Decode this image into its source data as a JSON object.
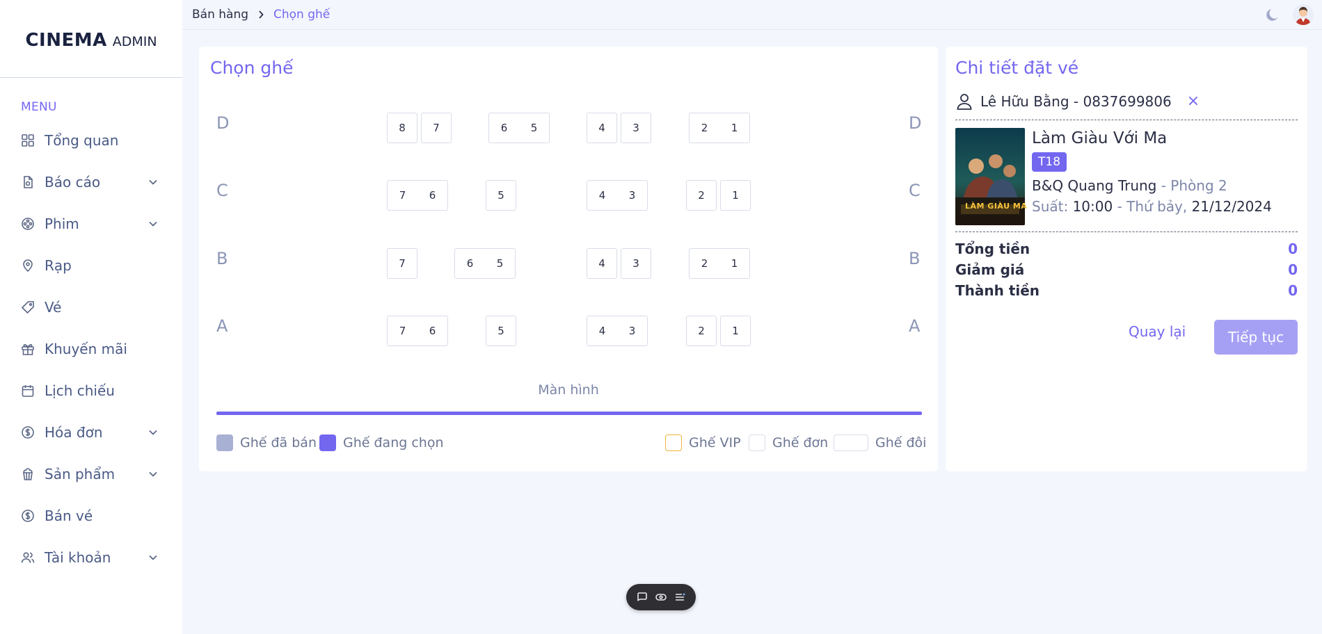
{
  "sidebar": {
    "logo_big": "CINEMA",
    "logo_small": "ADMIN",
    "menu_title": "MENU",
    "items": [
      {
        "label": "Tổng quan",
        "icon": "grid-icon"
      },
      {
        "label": "Báo cáo",
        "icon": "report-icon",
        "expandable": true
      },
      {
        "label": "Phim",
        "icon": "film-reel-icon",
        "expandable": true
      },
      {
        "label": "Rạp",
        "icon": "map-pin-icon"
      },
      {
        "label": "Vé",
        "icon": "ticket-tag-icon"
      },
      {
        "label": "Khuyến mãi",
        "icon": "gift-icon"
      },
      {
        "label": "Lịch chiếu",
        "icon": "calendar-icon"
      },
      {
        "label": "Hóa đơn",
        "icon": "dollar-circle-icon",
        "expandable": true
      },
      {
        "label": "Sản phẩm",
        "icon": "popcorn-icon",
        "expandable": true
      },
      {
        "label": "Bán vé",
        "icon": "dollar-circle-icon"
      },
      {
        "label": "Tài khoản",
        "icon": "users-icon",
        "expandable": true
      }
    ]
  },
  "topbar": {
    "breadcrumb": [
      "Bán hàng",
      "Chọn ghế"
    ]
  },
  "seat_map": {
    "title": "Chọn ghế",
    "rows": [
      {
        "label": "D",
        "seats": [
          "8",
          "7",
          "6",
          "5",
          "4",
          "3",
          "2",
          "1"
        ]
      },
      {
        "label": "C",
        "seats": [
          "7",
          "6",
          "5",
          "4",
          "3",
          "2",
          "1"
        ]
      },
      {
        "label": "B",
        "seats": [
          "7",
          "6",
          "5",
          "4",
          "3",
          "2",
          "1"
        ]
      },
      {
        "label": "A",
        "seats": [
          "7",
          "6",
          "5",
          "4",
          "3",
          "2",
          "1"
        ]
      }
    ],
    "screen_label": "Màn hình",
    "legend": {
      "sold": "Ghế đã bán",
      "selecting": "Ghế đang chọn",
      "vip": "Ghế VIP",
      "single": "Ghế đơn",
      "double": "Ghế đôi"
    },
    "colors": {
      "accent": "#7367f0",
      "sold": "#a8b0d4",
      "vip_border": "#f0b53a"
    }
  },
  "booking": {
    "title": "Chi tiết đặt vé",
    "customer": "Lê Hữu Bằng - 0837699806",
    "remove_symbol": "×",
    "movie": {
      "title": "Làm Giàu Với Ma",
      "rating": "T18",
      "poster_text": "LÀM GIÀU MA",
      "cinema": "B&Q Quang Trung",
      "room": " - Phòng 2",
      "time_prefix": "Suất: ",
      "time": "10:00",
      "day_sep": " - Thứ bảy, ",
      "date": "21/12/2024"
    },
    "totals": [
      {
        "label": "Tổng tiền",
        "value": "0"
      },
      {
        "label": "Giảm giá",
        "value": "0"
      },
      {
        "label": "Thành tiền",
        "value": "0"
      }
    ],
    "back_label": "Quay lại",
    "next_label": "Tiếp tục"
  }
}
